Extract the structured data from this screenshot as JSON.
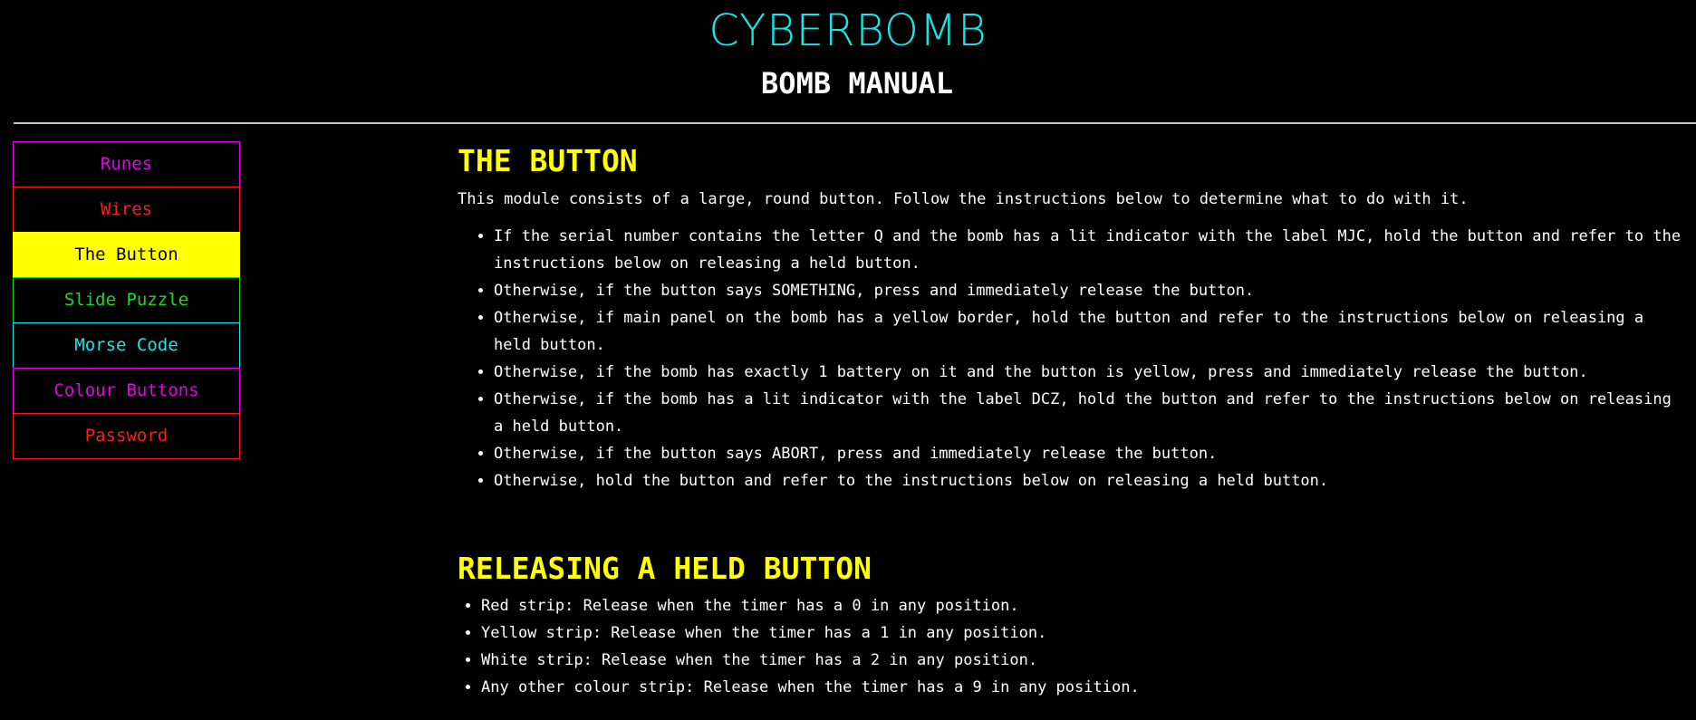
{
  "header": {
    "brand": "CYBERBOMB",
    "subtitle": "BOMB MANUAL"
  },
  "nav": {
    "items": [
      {
        "label": "Runes",
        "color": "#e600e6",
        "active": false
      },
      {
        "label": "Wires",
        "color": "#ff1a1a",
        "active": false
      },
      {
        "label": "The Button",
        "color": "#ffff00",
        "active": true
      },
      {
        "label": "Slide Puzzle",
        "color": "#1adc1a",
        "active": false
      },
      {
        "label": "Morse Code",
        "color": "#18e6e6",
        "active": false
      },
      {
        "label": "Colour Buttons",
        "color": "#e600e6",
        "active": false
      },
      {
        "label": "Password",
        "color": "#ff1a1a",
        "active": false
      }
    ]
  },
  "main": {
    "title": "THE BUTTON",
    "intro": "This module consists of a large, round button. Follow the instructions below to determine what to do with it.",
    "rules": [
      "If the serial number contains the letter Q and the bomb has a lit indicator with the label MJC, hold the button and refer to the instructions below on releasing a held button.",
      "Otherwise, if the button says SOMETHING, press and immediately release the button.",
      "Otherwise, if main panel on the bomb has a yellow border, hold the button and refer to the instructions below on releasing a held button.",
      "Otherwise, if the bomb has exactly 1 battery on it and the button is yellow, press and immediately release the button.",
      "Otherwise, if the bomb has a lit indicator with the label DCZ, hold the button and refer to the instructions below on releasing a held button.",
      "Otherwise, if the button says ABORT, press and immediately release the button.",
      "Otherwise, hold the button and refer to the instructions below on releasing a held button."
    ]
  },
  "release": {
    "title": "RELEASING A HELD BUTTON",
    "strips": [
      "Red strip: Release when the timer has a 0 in any position.",
      "Yellow strip: Release when the timer has a 1 in any position.",
      "White strip: Release when the timer has a 2 in any position.",
      "Any other colour strip: Release when the timer has a 9 in any position."
    ]
  },
  "colors": {
    "background": "#000000",
    "brand": "#18e6e6",
    "heading": "#ffff00",
    "text": "#ffffff"
  }
}
